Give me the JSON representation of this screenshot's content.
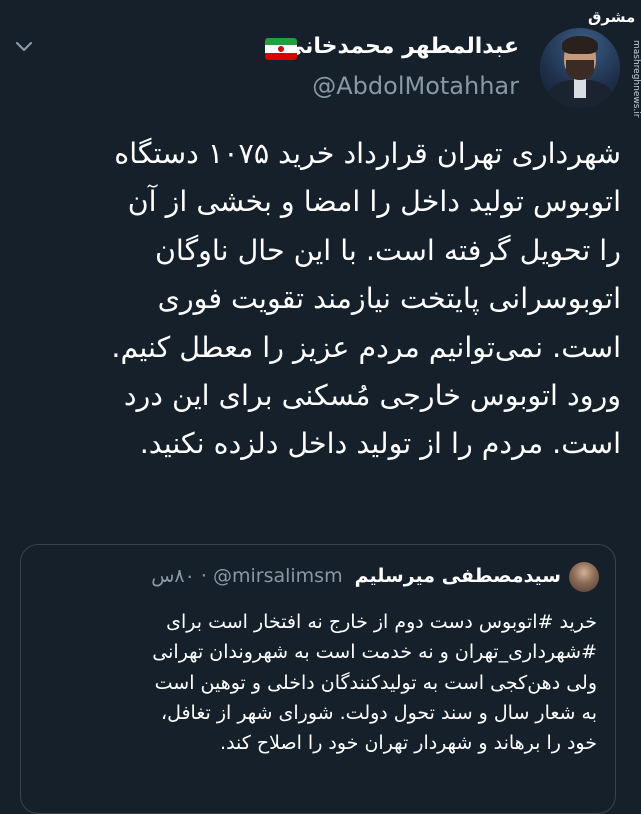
{
  "watermark": {
    "logo": "مشرق",
    "site": "mashreghnews.ir"
  },
  "author": {
    "name": "عبدالمطهر محمدخانی",
    "handle": "@AbdolMotahhar"
  },
  "tweet": {
    "lines": [
      "شهرداری تهران قرارداد خرید ۱۰۷۵ دستگاه",
      "اتوبوس تولید داخل را امضا و بخشی از آن",
      "را تحویل گرفته است. با این حال ناوگان",
      "اتوبوسرانی پایتخت نیازمند تقویت فوری",
      "است. نمی‌توانیم مردم عزیز را معطل کنیم.",
      "ورود اتوبوس خارجی مُسکنی برای این درد",
      "است. مردم را از تولید داخل دلزده نکنید."
    ]
  },
  "quoted": {
    "name": "سیدمصطفی میرسلیم",
    "handle": "@mirsalimsm",
    "time": "۸۰س",
    "lines": [
      "خرید #اتوبوس دست دوم از خارج نه افتخار است برای",
      "#شهرداری_تهران و نه خدمت است به شهروندان تهرانی",
      "ولی دهن‌کجی است به تولیدکنندگان داخلی و توهین است",
      "به شعار سال و سند تحول دولت. شورای شهر از تغافل،",
      "خود را برهاند و شهردار تهران خود را اصلاح کند."
    ]
  },
  "colors": {
    "background": "#15202b",
    "muted": "#8899a6",
    "border": "#38444d"
  }
}
